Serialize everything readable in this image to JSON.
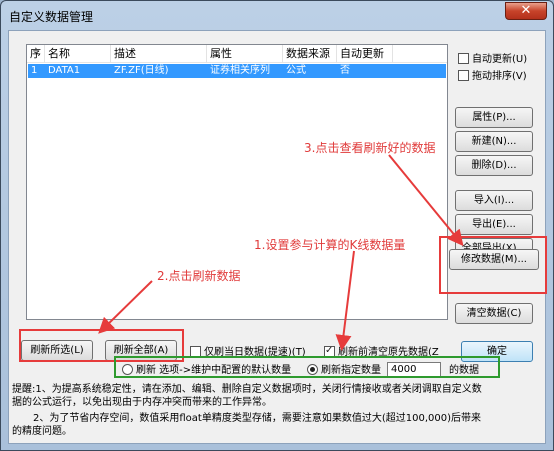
{
  "window": {
    "title": "自定义数据管理",
    "close_label": "✕"
  },
  "list": {
    "columns": [
      "序",
      "名称",
      "描述",
      "属性",
      "数据来源",
      "自动更新"
    ],
    "rows": [
      {
        "index": "1",
        "name": "DATA1",
        "description": "ZF.ZF(日线)",
        "attribute": "证券相关序列",
        "source": "公式",
        "auto_update": "否"
      }
    ]
  },
  "options": {
    "auto_update": "自动更新(U)",
    "drag_sort": "拖动排序(V)"
  },
  "buttons": {
    "properties": "属性(P)...",
    "new": "新建(N)...",
    "delete": "删除(D)...",
    "import": "导入(I)...",
    "export": "导出(E)...",
    "export_all": "全部导出(X)...",
    "modify_data": "修改数据(M)...",
    "clear_data": "清空数据(C)",
    "refresh_selected": "刷新所选(L)",
    "refresh_all": "刷新全部(A)",
    "ok": "确定"
  },
  "refresh": {
    "today_only": "仅刷当日数据(提速)(T)",
    "clear_before": "刷新前清空原先数据(Z",
    "radio_default": "刷新 选项->维护中配置的默认数量",
    "radio_specified": "刷新指定数量",
    "specified_value": "4000",
    "specified_suffix": "的数据"
  },
  "notes": {
    "line1": "提醒:1、为提高系统稳定性，请在添加、编辑、删除自定义数据项时，关闭行情接收或者关闭调取自定义数",
    "line2": "据的公式运行，以免出现由于内存冲突而带来的工作异常。",
    "line3": "2、为了节省内存空间，数值采用float单精度类型存储，需要注意如果数值过大(超过100,000)后带来",
    "line4": "的精度问题。"
  },
  "annotations": {
    "step1": "1.设置参与计算的K线数据量",
    "step2": "2.点击刷新数据",
    "step3": "3.点击查看刷新好的数据"
  },
  "colors": {
    "annotation_red": "#e63b3b",
    "annotation_green": "#2e9a2e",
    "selection": "#3399ff"
  }
}
